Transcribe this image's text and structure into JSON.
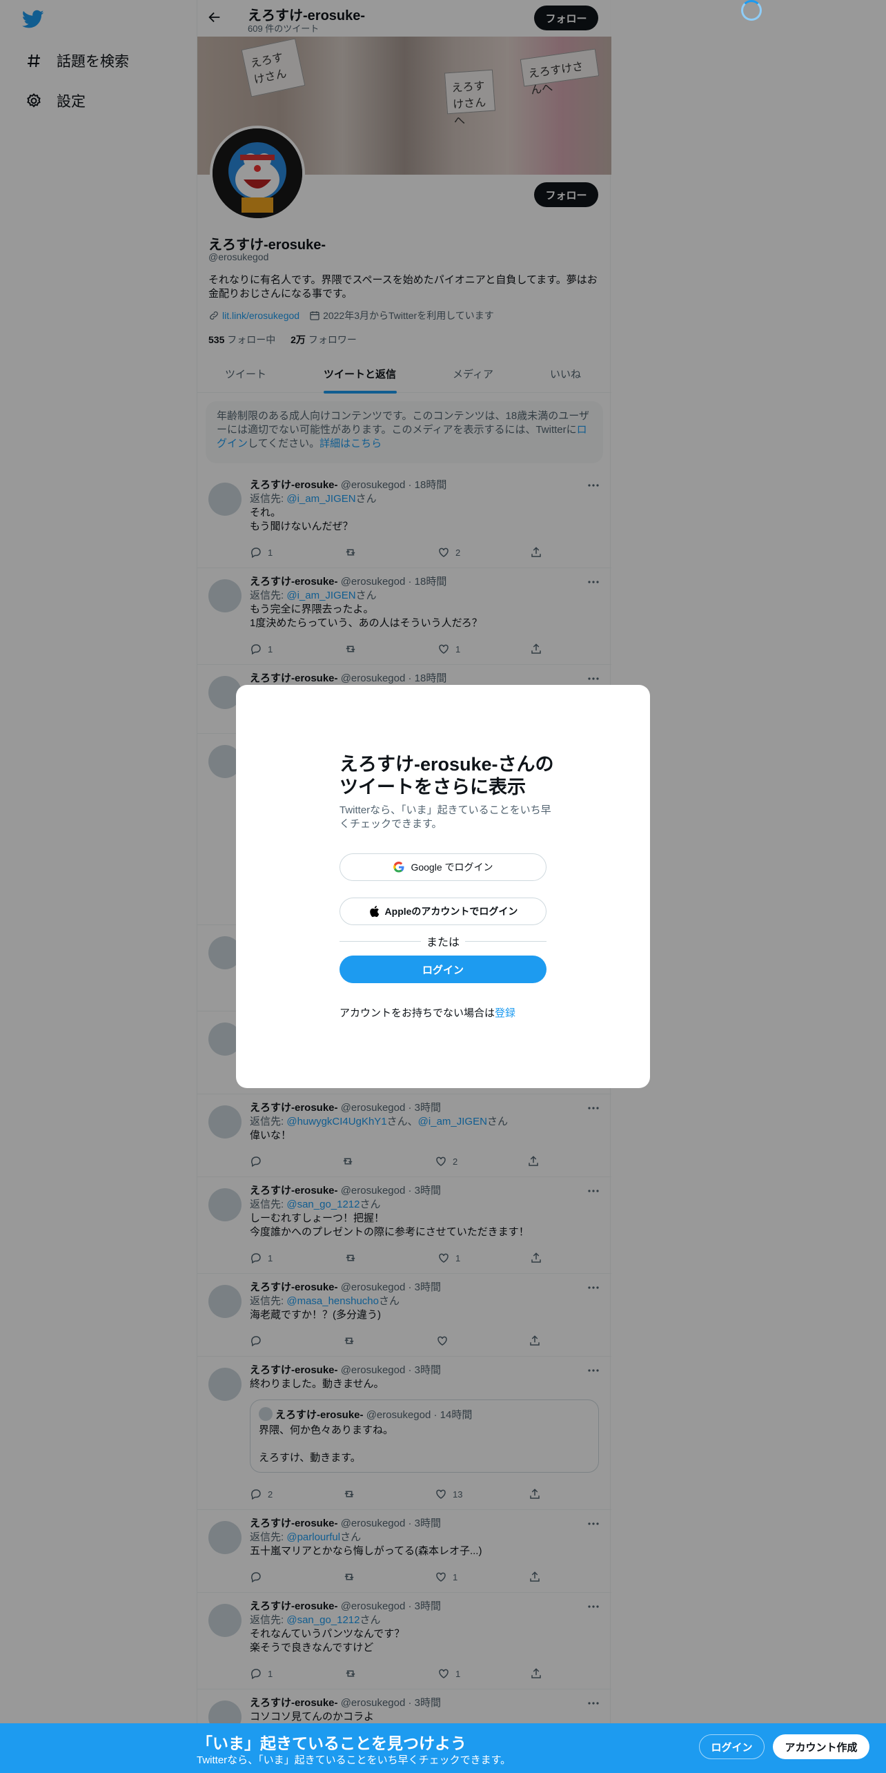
{
  "sidebar": {
    "logo": "twitter-bird-icon",
    "items": [
      {
        "label": "話題を検索",
        "icon": "hashtag-icon"
      },
      {
        "label": "設定",
        "icon": "gear-icon"
      }
    ]
  },
  "header": {
    "name": "えろすけ-erosuke-",
    "tweet_count": "609 件のツイート",
    "follow_label": "フォロー"
  },
  "banner": {
    "card1": "えろすけさん",
    "card2": "えろすけさんへ",
    "card3": "えろすけさんへ"
  },
  "profile": {
    "name": "えろすけ-erosuke-",
    "handle": "@erosukegod",
    "follow_label": "フォロー",
    "bio": "それなりに有名人です。界隈でスペースを始めたパイオニアと自負してます。夢はお金配りおじさんになる事です。",
    "link": "lit.link/erosukegod",
    "joined": "2022年3月からTwitterを利用しています",
    "following_count": "535",
    "following_label": " フォロー中",
    "followers_count": "2万",
    "followers_label": " フォロワー"
  },
  "tabs": [
    "ツイート",
    "ツイートと返信",
    "メディア",
    "いいね"
  ],
  "notice": {
    "text1": "年齢制限のある成人向けコンテンツです。このコンテンツは、18歳未満のユーザーには適切でない可能性があります。このメディアを表示するには、Twitterに",
    "login_link": "ログイン",
    "text2": "してください。",
    "details_link": "詳細はこちら"
  },
  "tweets": [
    {
      "name": "えろすけ-erosuke-",
      "handle": "@erosukegod",
      "time": "18時間",
      "reply_prefix": "返信先: ",
      "reply_to": "@i_am_JIGEN",
      "reply_suffix": "さん",
      "line1": "それ。",
      "line2": "もう聞けないんだぜ？",
      "replies": "1",
      "retweets": "",
      "likes": "2"
    },
    {
      "name": "えろすけ-erosuke-",
      "handle": "@erosukegod",
      "time": "18時間",
      "reply_prefix": "返信先: ",
      "reply_to": "@i_am_JIGEN",
      "reply_suffix": "さん",
      "line1": "もう完全に界隈去ったよ。",
      "line2": "1度決めたらっていう、あの人はそういう人だろ？",
      "replies": "1",
      "retweets": "",
      "likes": "1"
    },
    {
      "name": "えろすけ-erosuke-",
      "handle": "@erosukegod",
      "time": "18時間"
    },
    {
      "name": "えろすけ-erosuke-",
      "handle": "@erosukegod",
      "time": "3時間",
      "reply_prefix": "返信先: ",
      "reply_to": "@huwygkCI4UgKhY1",
      "reply_mid": "さん、",
      "reply_to2": "@i_am_JIGEN",
      "reply_suffix": "さん",
      "line1": "偉いな！",
      "replies": "",
      "retweets": "",
      "likes": "2"
    },
    {
      "name": "えろすけ-erosuke-",
      "handle": "@erosukegod",
      "time": "3時間",
      "reply_prefix": "返信先: ",
      "reply_to": "@san_go_1212",
      "reply_suffix": "さん",
      "line1": "しーむれすしょーつ！把握！",
      "line2": "今度誰かへのプレゼントの際に参考にさせていただきます！",
      "replies": "1",
      "retweets": "",
      "likes": "1"
    },
    {
      "name": "えろすけ-erosuke-",
      "handle": "@erosukegod",
      "time": "3時間",
      "reply_prefix": "返信先: ",
      "reply_to": "@masa_henshucho",
      "reply_suffix": "さん",
      "line1": "海老蔵ですか！？(多分違う)",
      "replies": "",
      "retweets": "",
      "likes": ""
    },
    {
      "name": "えろすけ-erosuke-",
      "handle": "@erosukegod",
      "time": "3時間",
      "line1": "終わりました。動きません。",
      "quote_name": "えろすけ-erosuke-",
      "quote_handle": "@erosukegod",
      "quote_time": "14時間",
      "quote_line1": "界隈、何か色々ありますね。",
      "quote_line2": "えろすけ、動きます。",
      "replies": "2",
      "retweets": "",
      "likes": "13"
    },
    {
      "name": "えろすけ-erosuke-",
      "handle": "@erosukegod",
      "time": "3時間",
      "reply_prefix": "返信先: ",
      "reply_to": "@parlourful",
      "reply_suffix": "さん",
      "line1": "五十嵐マリアとかなら悔しがってる(森本レオ子...)",
      "replies": "",
      "retweets": "",
      "likes": "1"
    },
    {
      "name": "えろすけ-erosuke-",
      "handle": "@erosukegod",
      "time": "3時間",
      "reply_prefix": "返信先: ",
      "reply_to": "@san_go_1212",
      "reply_suffix": "さん",
      "line1": "それなんていうパンツなんです？",
      "line2": "楽そうで良きなんですけど",
      "replies": "1",
      "retweets": "",
      "likes": "1"
    },
    {
      "name": "えろすけ-erosuke-",
      "handle": "@erosukegod",
      "time": "3時間",
      "line1": "コソコソ見てんのかコラよ"
    }
  ],
  "modal": {
    "title": "えろすけ-erosuke-さんのツイートをさらに表示",
    "subtitle": "Twitterなら、「いま」起きていることをいち早くチェックできます。",
    "google_label": "Google でログイン",
    "apple_label": "Appleのアカウントでログイン",
    "or_label": "または",
    "login_label": "ログイン",
    "signup_text": "アカウントをお持ちでない場合は",
    "signup_link": "登録"
  },
  "bottom_bar": {
    "title": "「いま」起きていることを見つけよう",
    "subtitle": "Twitterなら、「いま」起きていることをいち早くチェックできます。",
    "login_label": "ログイン",
    "signup_label": "アカウント作成"
  },
  "colors": {
    "accent": "#1d9bf0",
    "text": "#0f1419",
    "muted": "#536471"
  }
}
